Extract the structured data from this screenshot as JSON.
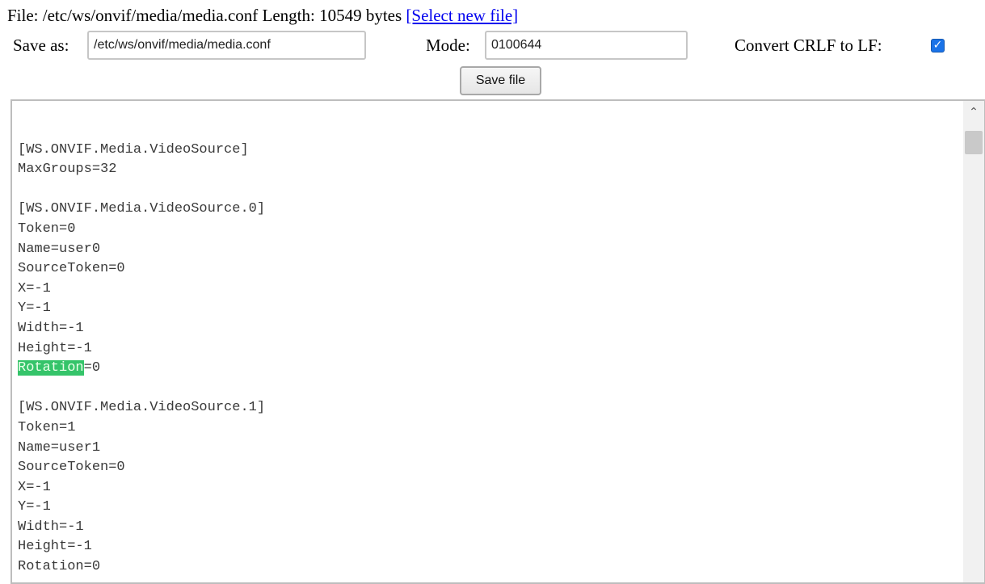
{
  "file_info": {
    "prefix": "File: /etc/ws/onvif/media/media.conf Length: 10549 bytes",
    "select_link": "[Select new file]"
  },
  "form": {
    "save_as_label": "Save as:",
    "save_as_value": "/etc/ws/onvif/media/media.conf",
    "mode_label": "Mode:",
    "mode_value": "0100644",
    "crlf_label": "Convert CRLF to LF:",
    "crlf_checked": true,
    "save_button": "Save file"
  },
  "editor": {
    "lines": [
      "",
      "[WS.ONVIF.Media.VideoSource]",
      "MaxGroups=32",
      "",
      "[WS.ONVIF.Media.VideoSource.0]",
      "Token=0",
      "Name=user0",
      "SourceToken=0",
      "X=-1",
      "Y=-1",
      "Width=-1",
      "Height=-1",
      "Rotation=0",
      "",
      "[WS.ONVIF.Media.VideoSource.1]",
      "Token=1",
      "Name=user1",
      "SourceToken=0",
      "X=-1",
      "Y=-1",
      "Width=-1",
      "Height=-1",
      "Rotation=0"
    ],
    "highlight": {
      "line": 12,
      "text": "Rotation"
    }
  },
  "icons": {
    "scroll_up": "chevron-up-icon",
    "checkbox": "checkmark-icon"
  }
}
